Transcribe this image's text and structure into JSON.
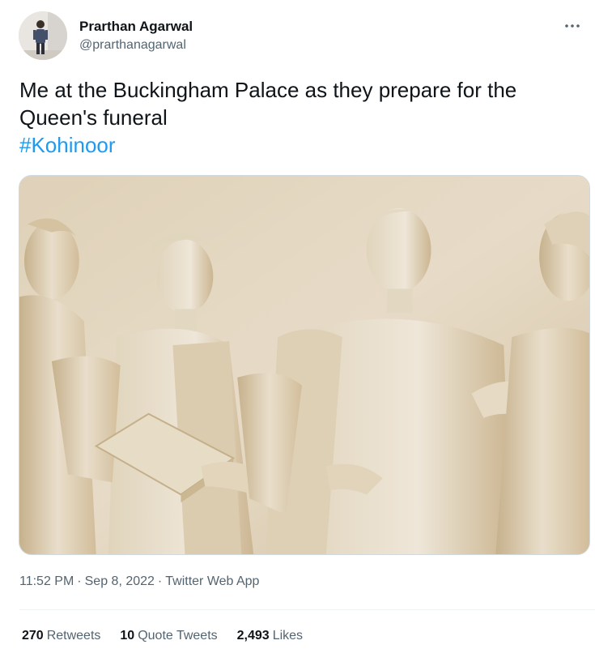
{
  "author": {
    "display_name": "Prarthan Agarwal",
    "handle": "@prarthanagarwal"
  },
  "tweet": {
    "text_line1": "Me at the Buckingham Palace as they prepare for the",
    "text_line2": "Queen's funeral",
    "hashtag": "#Kohinoor",
    "hashtag_color": "#1d9bf0"
  },
  "media": {
    "icon": "statue-relief-photo"
  },
  "meta": {
    "time": "11:52 PM",
    "separator": "·",
    "date": "Sep 8, 2022",
    "source": "Twitter Web App"
  },
  "stats": {
    "retweets_count": "270",
    "retweets_label": "Retweets",
    "quotes_count": "10",
    "quotes_label": "Quote Tweets",
    "likes_count": "2,493",
    "likes_label": "Likes"
  },
  "colors": {
    "text_primary": "#0f1419",
    "text_secondary": "#536471",
    "link": "#1d9bf0",
    "divider": "#eff3f4"
  }
}
